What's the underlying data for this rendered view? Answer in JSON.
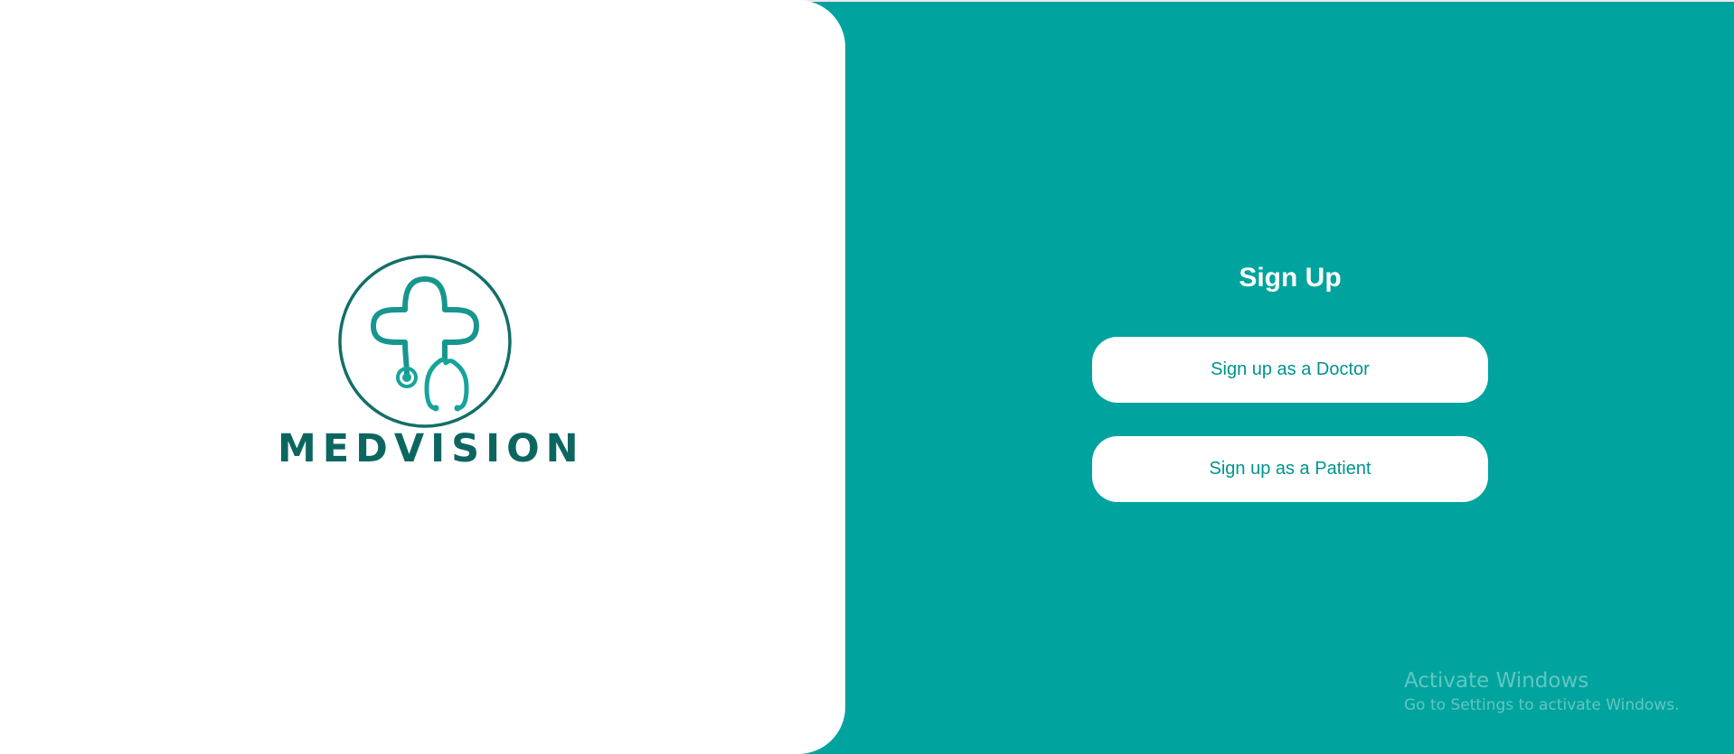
{
  "brand": {
    "name": "MEDVISION",
    "logo_icon": "cross-stethoscope-icon",
    "colors": {
      "dark_teal": "#0c6660",
      "teal": "#17a39a"
    }
  },
  "signup": {
    "title": "Sign Up",
    "doctor_button_label": "Sign up as a Doctor",
    "patient_button_label": "Sign up as a Patient"
  },
  "watermark": {
    "title": "Activate Windows",
    "subtitle": "Go to Settings to activate Windows."
  },
  "colors": {
    "background": "#00a39d",
    "panel": "#ffffff",
    "button_text": "#00938d"
  }
}
